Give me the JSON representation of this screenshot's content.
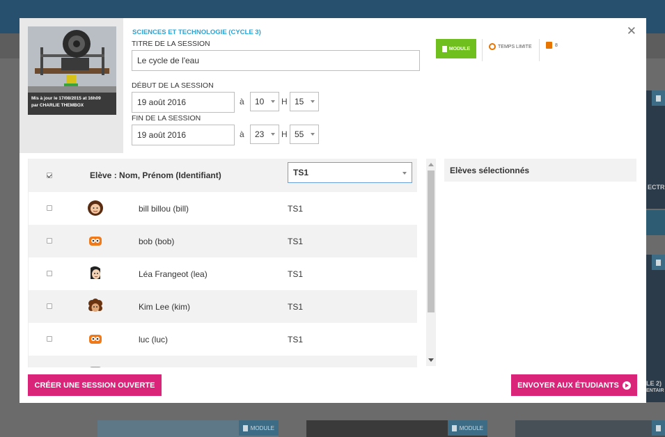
{
  "background": {
    "module_tags": [
      "MODULE",
      "MODULE"
    ],
    "card_fragments": [
      "ECTR",
      "LE 2)",
      "ENTAIR"
    ]
  },
  "modal": {
    "subject": "SCIENCES ET TECHNOLOGIE (CYCLE 3)",
    "thumbnail_caption_line1": "Mis à jour le 17/08/2015 at 16h09",
    "thumbnail_caption_line2": "par CHARLIE THEMBOX",
    "title_label": "TITRE DE LA SESSION",
    "title_value": "Le cycle de l'eau",
    "start": {
      "label": "DÉBUT DE LA SESSION",
      "date": "19 août 2016",
      "at": "à",
      "hour": "10",
      "h_sep": "H",
      "minute": "15"
    },
    "end": {
      "label": "FIN DE LA SESSION",
      "date": "19 août 2016",
      "at": "à",
      "hour": "23",
      "h_sep": "H",
      "minute": "55"
    },
    "badges": {
      "module": "MODULE",
      "time_limit": "TEMPS LIMITE",
      "count": "8"
    },
    "table": {
      "header": "Elève : Nom, Prénom (Identifiant)",
      "class_filter": "TS1",
      "rows": [
        {
          "name": "bill billou (bill)",
          "class": "TS1",
          "avatar": "girl-face-avatar"
        },
        {
          "name": "bob (bob)",
          "class": "TS1",
          "avatar": "orange-robot-avatar"
        },
        {
          "name": "Léa Frangeot (lea)",
          "class": "TS1",
          "avatar": "dark-hair-girl-avatar"
        },
        {
          "name": "Kim Lee (kim)",
          "class": "TS1",
          "avatar": "curly-girl-avatar"
        },
        {
          "name": "luc (luc)",
          "class": "TS1",
          "avatar": "orange-robot-avatar"
        }
      ]
    },
    "selected_title": "Elèves sélectionnés",
    "buttons": {
      "open_session": "CRÉER UNE SESSION OUVERTE",
      "send": "ENVOYER AUX ÉTUDIANTS"
    },
    "colors": {
      "accent_pink": "#d9247a",
      "module_green": "#6fbf1e",
      "subject_blue": "#2aa4d6",
      "icon_orange": "#e87400"
    }
  }
}
